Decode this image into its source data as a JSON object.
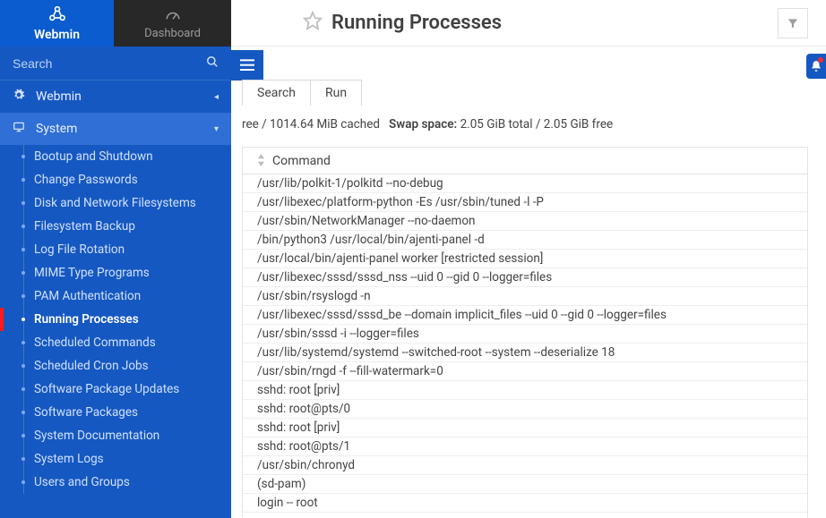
{
  "brand": {
    "name": "Webmin"
  },
  "dashboard_tab": "Dashboard",
  "search": {
    "placeholder": "Search"
  },
  "nav": {
    "webmin": "Webmin",
    "system": "System",
    "items": [
      "Bootup and Shutdown",
      "Change Passwords",
      "Disk and Network Filesystems",
      "Filesystem Backup",
      "Log File Rotation",
      "MIME Type Programs",
      "PAM Authentication",
      "Running Processes",
      "Scheduled Commands",
      "Scheduled Cron Jobs",
      "Software Package Updates",
      "Software Packages",
      "System Documentation",
      "System Logs",
      "Users and Groups"
    ],
    "active_index": 7
  },
  "page": {
    "title": "Running Processes",
    "tabs": [
      "Search",
      "Run"
    ],
    "mem_tail": "ree / 1014.64 MiB cached",
    "swap_label": "Swap space:",
    "swap_value": "2.05 GiB total / 2.05 GiB free",
    "col_header": "Command",
    "rows": [
      "/usr/lib/polkit-1/polkitd --no-debug",
      "/usr/libexec/platform-python -Es /usr/sbin/tuned -l -P",
      "/usr/sbin/NetworkManager --no-daemon",
      "/bin/python3 /usr/local/bin/ajenti-panel -d",
      "/usr/local/bin/ajenti-panel worker [restricted session]",
      "/usr/libexec/sssd/sssd_nss --uid 0 --gid 0 --logger=files",
      "/usr/sbin/rsyslogd -n",
      "/usr/libexec/sssd/sssd_be --domain implicit_files --uid 0 --gid 0 --logger=files",
      "/usr/sbin/sssd -i --logger=files",
      "/usr/lib/systemd/systemd --switched-root --system --deserialize 18",
      "/usr/sbin/rngd -f --fill-watermark=0",
      "sshd: root [priv]",
      "sshd: root@pts/0",
      "sshd: root [priv]",
      "sshd: root@pts/1",
      "/usr/sbin/chronyd",
      "(sd-pam)",
      "login -- root"
    ]
  }
}
